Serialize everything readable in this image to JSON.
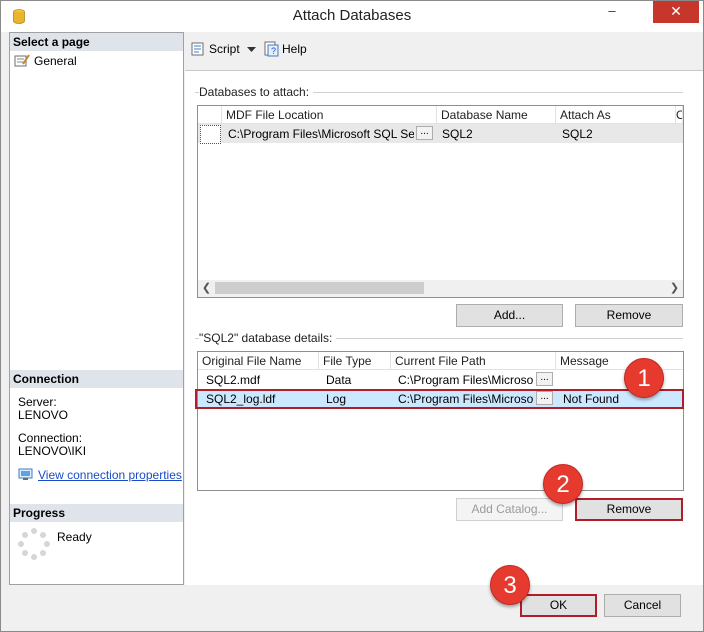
{
  "window": {
    "title": "Attach Databases",
    "minimize": "–",
    "close": "✕"
  },
  "left": {
    "select_page_header": "Select a page",
    "pages": [
      "General"
    ],
    "connection_header": "Connection",
    "server_label": "Server:",
    "server_value": "LENOVO",
    "connection_label": "Connection:",
    "connection_value": "LENOVO\\IKI",
    "view_props_link": "View connection properties",
    "progress_header": "Progress",
    "progress_status": "Ready"
  },
  "toolbar": {
    "script_label": "Script",
    "help_label": "Help"
  },
  "attach": {
    "group_label": "Databases to attach:",
    "columns": [
      "MDF File Location",
      "Database Name",
      "Attach As",
      "O"
    ],
    "rows": [
      {
        "mdf": "C:\\Program Files\\Microsoft SQL Ser...",
        "browse": "...",
        "db_name": "SQL2",
        "attach_as": "SQL2"
      }
    ],
    "add_button": "Add...",
    "remove_button": "Remove"
  },
  "details": {
    "group_label": "\"SQL2\" database details:",
    "columns": [
      "Original File Name",
      "File Type",
      "Current File Path",
      "Message"
    ],
    "rows": [
      {
        "name": "SQL2.mdf",
        "type": "Data",
        "path": "C:\\Program Files\\Microso...",
        "browse": "...",
        "message": ""
      },
      {
        "name": "SQL2_log.ldf",
        "type": "Log",
        "path": "C:\\Program Files\\Microso...",
        "browse": "...",
        "message": "Not Found"
      }
    ],
    "add_catalog_button": "Add Catalog...",
    "remove_button": "Remove"
  },
  "footer": {
    "ok_button": "OK",
    "cancel_button": "Cancel"
  },
  "callouts": [
    "1",
    "2",
    "3"
  ],
  "colors": {
    "highlight_box": "#b01e2a",
    "callout": "#e63a2f",
    "selected_row": "#cce8ff",
    "link": "#1a4bc9"
  }
}
